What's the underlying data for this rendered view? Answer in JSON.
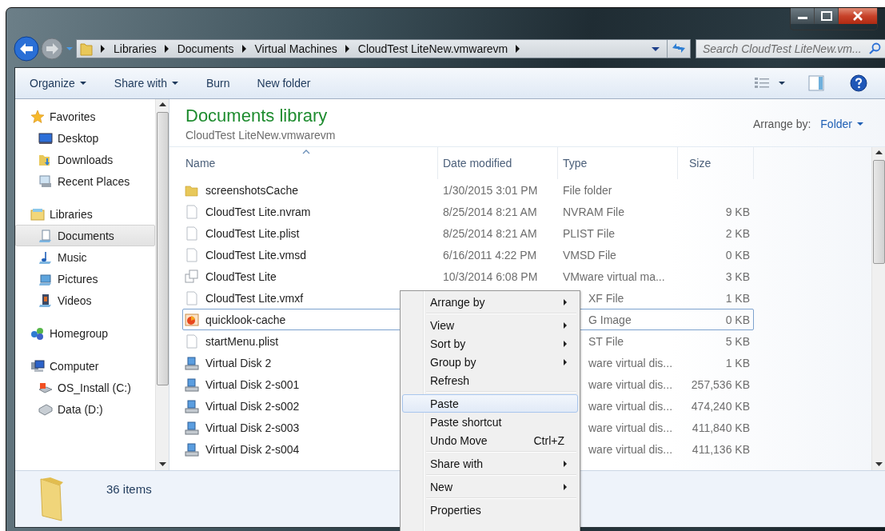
{
  "address_bar": {
    "segments": [
      "Libraries",
      "Documents",
      "Virtual Machines",
      "CloudTest LiteNew.vmwarevm"
    ]
  },
  "search": {
    "placeholder": "Search CloudTest LiteNew.vm..."
  },
  "toolbar": {
    "buttons": [
      {
        "label": "Organize",
        "dropdown": true
      },
      {
        "label": "Share with",
        "dropdown": true
      },
      {
        "label": "Burn",
        "dropdown": false
      },
      {
        "label": "New folder",
        "dropdown": false
      }
    ]
  },
  "nav_pane": {
    "groups": [
      {
        "label": "Favorites",
        "kind": "favorites",
        "selected": false,
        "children": [
          {
            "label": "Desktop",
            "kind": "desktop",
            "selected": false
          },
          {
            "label": "Downloads",
            "kind": "downloads",
            "selected": false
          },
          {
            "label": "Recent Places",
            "kind": "recent",
            "selected": false
          }
        ]
      },
      {
        "label": "Libraries",
        "kind": "libraries",
        "selected": false,
        "children": [
          {
            "label": "Documents",
            "kind": "documents",
            "selected": true
          },
          {
            "label": "Music",
            "kind": "music",
            "selected": false
          },
          {
            "label": "Pictures",
            "kind": "pictures",
            "selected": false
          },
          {
            "label": "Videos",
            "kind": "videos",
            "selected": false
          }
        ]
      },
      {
        "label": "Homegroup",
        "kind": "homegroup",
        "selected": false
      },
      {
        "label": "Computer",
        "kind": "computer",
        "selected": false,
        "children": [
          {
            "label": "OS_Install (C:)",
            "kind": "drive-os",
            "selected": false
          },
          {
            "label": "Data (D:)",
            "kind": "drive",
            "selected": false
          }
        ]
      }
    ]
  },
  "library_header": {
    "title": "Documents library",
    "subtitle": "CloudTest LiteNew.vmwarevm",
    "arrange_label": "Arrange by:",
    "arrange_value": "Folder"
  },
  "table": {
    "columns": [
      {
        "label": "Name",
        "sorted": true
      },
      {
        "label": "Date modified",
        "sorted": false
      },
      {
        "label": "Type",
        "sorted": false
      },
      {
        "label": "Size",
        "sorted": false
      }
    ],
    "rows": [
      {
        "kind": "folder",
        "name": "screenshotsCache",
        "date": "1/30/2015 3:01 PM",
        "type": "File folder",
        "focused": false
      },
      {
        "kind": "file",
        "name": "CloudTest Lite.nvram",
        "date": "8/25/2014 8:21 AM",
        "type": "NVRAM File",
        "size": "9 KB",
        "focused": false
      },
      {
        "kind": "file",
        "name": "CloudTest Lite.plist",
        "date": "8/25/2014 8:21 AM",
        "type": "PLIST File",
        "size": "2 KB",
        "focused": false
      },
      {
        "kind": "file",
        "name": "CloudTest Lite.vmsd",
        "date": "6/16/2011 4:22 PM",
        "type": "VMSD File",
        "size": "0 KB",
        "focused": false
      },
      {
        "kind": "vm",
        "name": "CloudTest Lite",
        "date": "10/3/2014 6:08 PM",
        "type": "VMware virtual ma...",
        "size": "3 KB",
        "focused": false
      },
      {
        "kind": "file",
        "name": "CloudTest Lite.vmxf",
        "type": "XF File",
        "size": "1 KB",
        "focused": false
      },
      {
        "kind": "image",
        "name": "quicklook-cache",
        "type": "G Image",
        "size": "0 KB",
        "focused": true
      },
      {
        "kind": "file",
        "name": "startMenu.plist",
        "type": "ST File",
        "size": "5 KB",
        "focused": false
      },
      {
        "kind": "disk",
        "name": "Virtual Disk 2",
        "type": "ware virtual dis...",
        "size": "1 KB",
        "focused": false
      },
      {
        "kind": "disk",
        "name": "Virtual Disk 2-s001",
        "type": "ware virtual dis...",
        "size": "257,536 KB",
        "focused": false
      },
      {
        "kind": "disk",
        "name": "Virtual Disk 2-s002",
        "type": "ware virtual dis...",
        "size": "474,240 KB",
        "focused": false
      },
      {
        "kind": "disk",
        "name": "Virtual Disk 2-s003",
        "type": "ware virtual dis...",
        "size": "411,840 KB",
        "focused": false
      },
      {
        "kind": "disk",
        "name": "Virtual Disk 2-s004",
        "type": "ware virtual dis...",
        "size": "411,136 KB",
        "focused": false
      }
    ]
  },
  "status_bar": {
    "item_count": "36 items"
  },
  "context_menu": {
    "items": [
      {
        "kind": "item",
        "label": "Arrange by",
        "submenu": true,
        "selected": false
      },
      {
        "kind": "separator"
      },
      {
        "kind": "item",
        "label": "View",
        "submenu": true,
        "selected": false
      },
      {
        "kind": "item",
        "label": "Sort by",
        "submenu": true,
        "selected": false
      },
      {
        "kind": "item",
        "label": "Group by",
        "submenu": true,
        "selected": false
      },
      {
        "kind": "item",
        "label": "Refresh",
        "submenu": false,
        "selected": false
      },
      {
        "kind": "separator"
      },
      {
        "kind": "item",
        "label": "Paste",
        "submenu": false,
        "selected": true
      },
      {
        "kind": "item",
        "label": "Paste shortcut",
        "submenu": false,
        "selected": false
      },
      {
        "kind": "item",
        "label": "Undo Move",
        "shortcut": "Ctrl+Z",
        "submenu": false,
        "selected": false
      },
      {
        "kind": "separator"
      },
      {
        "kind": "item",
        "label": "Share with",
        "submenu": true,
        "selected": false
      },
      {
        "kind": "separator"
      },
      {
        "kind": "item",
        "label": "New",
        "submenu": true,
        "selected": false
      },
      {
        "kind": "separator"
      },
      {
        "kind": "item",
        "label": "Properties",
        "submenu": false,
        "selected": false
      }
    ]
  }
}
